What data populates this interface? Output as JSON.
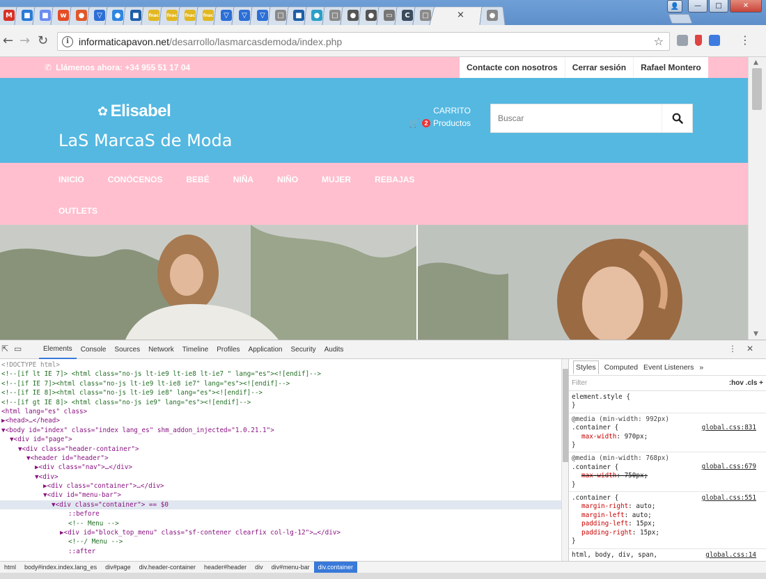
{
  "browser": {
    "tabs": [
      {
        "letter": "M",
        "color": "#d93025"
      },
      {
        "letter": "■",
        "color": "#2a7ad6"
      },
      {
        "letter": "■",
        "color": "#6c8cf0"
      },
      {
        "letter": "w",
        "color": "#e44d26"
      },
      {
        "letter": "●",
        "color": "#e1572a"
      },
      {
        "letter": "▽",
        "color": "#2c6fd6"
      },
      {
        "letter": "●",
        "color": "#2f86e0"
      },
      {
        "letter": "■",
        "color": "#1d5fa8"
      },
      {
        "letter": "fnac",
        "color": "#e2b721"
      },
      {
        "letter": "fnac",
        "color": "#e2b721"
      },
      {
        "letter": "fnac",
        "color": "#e2b721"
      },
      {
        "letter": "fnac",
        "color": "#e2b721"
      },
      {
        "letter": "▽",
        "color": "#2c6fd6"
      },
      {
        "letter": "▽",
        "color": "#2c6fd6"
      },
      {
        "letter": "▽",
        "color": "#2c6fd6"
      },
      {
        "letter": "□",
        "color": "#8a8a8a"
      },
      {
        "letter": "■",
        "color": "#1d5fa8"
      },
      {
        "letter": "●",
        "color": "#2aa0c7"
      },
      {
        "letter": "□",
        "color": "#8a8a8a"
      },
      {
        "letter": "●",
        "color": "#555"
      },
      {
        "letter": "●",
        "color": "#555"
      },
      {
        "letter": "▭",
        "color": "#777"
      },
      {
        "letter": "C",
        "color": "#3b4c5e"
      },
      {
        "letter": "□",
        "color": "#8a8a8a"
      },
      {
        "letter": "●",
        "color": "#888"
      }
    ],
    "active_tab_close": "×",
    "url_domain": "informaticapavon.net",
    "url_path": "/desarrollo/lasmarcasdemoda/index.php",
    "window_controls": {
      "user": "👤",
      "minimize": "—",
      "maximize": "□",
      "close": "✕"
    }
  },
  "site": {
    "topbar": {
      "call_text": "Llámenos ahora: +34 955 51 17 04",
      "links": [
        "Contacte con nosotros",
        "Cerrar sesión",
        "Rafael Montero"
      ]
    },
    "brand": {
      "logo_text": "Elisabel",
      "tagline": "LaS MarcaS de Moda"
    },
    "cart": {
      "title": "CARRITO",
      "count": "2",
      "label": "Productos"
    },
    "search": {
      "placeholder": "Buscar"
    },
    "menu": {
      "row1": [
        "INICIO",
        "CONÓCENOS",
        "BEBÉ",
        "NIÑA",
        "NIÑO",
        "MUJER",
        "REBAJAS"
      ],
      "row2": [
        "OUTLETS"
      ]
    },
    "colors": {
      "pink": "#ffbfcf",
      "blue": "#54b8e1"
    }
  },
  "devtools": {
    "tabs": [
      "Elements",
      "Console",
      "Sources",
      "Network",
      "Timeline",
      "Profiles",
      "Application",
      "Security",
      "Audits"
    ],
    "active_tab": "Elements",
    "styles_tabs": [
      "Styles",
      "Computed",
      "Event Listeners",
      "»"
    ],
    "filter_placeholder": "Filter",
    "filter_buttons": ":hov  .cls  +",
    "code": [
      {
        "t": "<!DOCTYPE html>",
        "cls": "c-muted",
        "indent": 0
      },
      {
        "t": "<!--[if lt IE 7]> <html class=\"no-js lt-ie9 lt-ie8 lt-ie7 \" lang=\"es\"><![endif]-->",
        "cls": "c-comment",
        "indent": 0
      },
      {
        "t": "<!--[if IE 7]><html class=\"no-js lt-ie9 lt-ie8 ie7\" lang=\"es\"><![endif]-->",
        "cls": "c-comment",
        "indent": 0
      },
      {
        "t": "<!--[if IE 8]><html class=\"no-js lt-ie9 ie8\" lang=\"es\"><![endif]-->",
        "cls": "c-comment",
        "indent": 0
      },
      {
        "t": "<!--[if gt IE 8]> <html class=\"no-js ie9\" lang=\"es\"><![endif]-->",
        "cls": "c-comment",
        "indent": 0
      },
      {
        "t": "<html lang=\"es\" class>",
        "cls": "c-tag",
        "indent": 0
      },
      {
        "t": "▶<head>…</head>",
        "cls": "c-tag",
        "indent": 0
      },
      {
        "t": "▼<body id=\"index\" class=\"index lang_es\" shm_addon_injected=\"1.0.21.1\">",
        "cls": "c-tag",
        "indent": 0
      },
      {
        "t": "▼<div id=\"page\">",
        "cls": "c-tag",
        "indent": 1
      },
      {
        "t": "▼<div class=\"header-container\">",
        "cls": "c-tag",
        "indent": 2
      },
      {
        "t": "▼<header id=\"header\">",
        "cls": "c-tag",
        "indent": 3
      },
      {
        "t": "▶<div class=\"nav\">…</div>",
        "cls": "c-tag",
        "indent": 4
      },
      {
        "t": "▼<div>",
        "cls": "c-tag",
        "indent": 4
      },
      {
        "t": "▶<div class=\"container\">…</div>",
        "cls": "c-tag",
        "indent": 5
      },
      {
        "t": "▼<div id=\"menu-bar\">",
        "cls": "c-tag",
        "indent": 5
      },
      {
        "t": "▼<div class=\"container\"> == $0",
        "cls": "c-tag",
        "indent": 6,
        "selected": true
      },
      {
        "t": "::before",
        "cls": "c-tag",
        "indent": 8
      },
      {
        "t": "<!-- Menu -->",
        "cls": "c-comment",
        "indent": 8
      },
      {
        "t": "▶<div id=\"block_top_menu\" class=\"sf-contener clearfix col-lg-12\">…</div>",
        "cls": "c-tag",
        "indent": 7
      },
      {
        "t": "<!--/ Menu -->",
        "cls": "c-comment",
        "indent": 8
      },
      {
        "t": "::after",
        "cls": "c-tag",
        "indent": 8
      }
    ],
    "rules": [
      {
        "selector": "element.style {",
        "media": "",
        "source": "",
        "props": [],
        "close": "}"
      },
      {
        "selector": ".container {",
        "media": "@media (min-width: 992px)",
        "source": "global.css:831",
        "props": [
          {
            "name": "max-width",
            "value": "970px;",
            "struck": false
          }
        ],
        "close": "}"
      },
      {
        "selector": ".container {",
        "media": "@media (min-width: 768px)",
        "source": "global.css:679",
        "props": [
          {
            "name": "max-width",
            "value": "750px;",
            "struck": true
          }
        ],
        "close": "}"
      },
      {
        "selector": ".container {",
        "media": "",
        "source": "global.css:551",
        "props": [
          {
            "name": "margin-right",
            "value": "auto;",
            "struck": false
          },
          {
            "name": "margin-left",
            "value": "auto;",
            "struck": false
          },
          {
            "name": "padding-left",
            "value": "15px;",
            "struck": false
          },
          {
            "name": "padding-right",
            "value": "15px;",
            "struck": false
          }
        ],
        "close": "}"
      },
      {
        "selector": "html, body, div, span,",
        "media": "",
        "source": "global.css:14",
        "props": [],
        "close": ""
      }
    ],
    "breadcrumbs": [
      "html",
      "body#index.index.lang_es",
      "div#page",
      "div.header-container",
      "header#header",
      "div",
      "div#menu-bar",
      "div.container"
    ]
  }
}
